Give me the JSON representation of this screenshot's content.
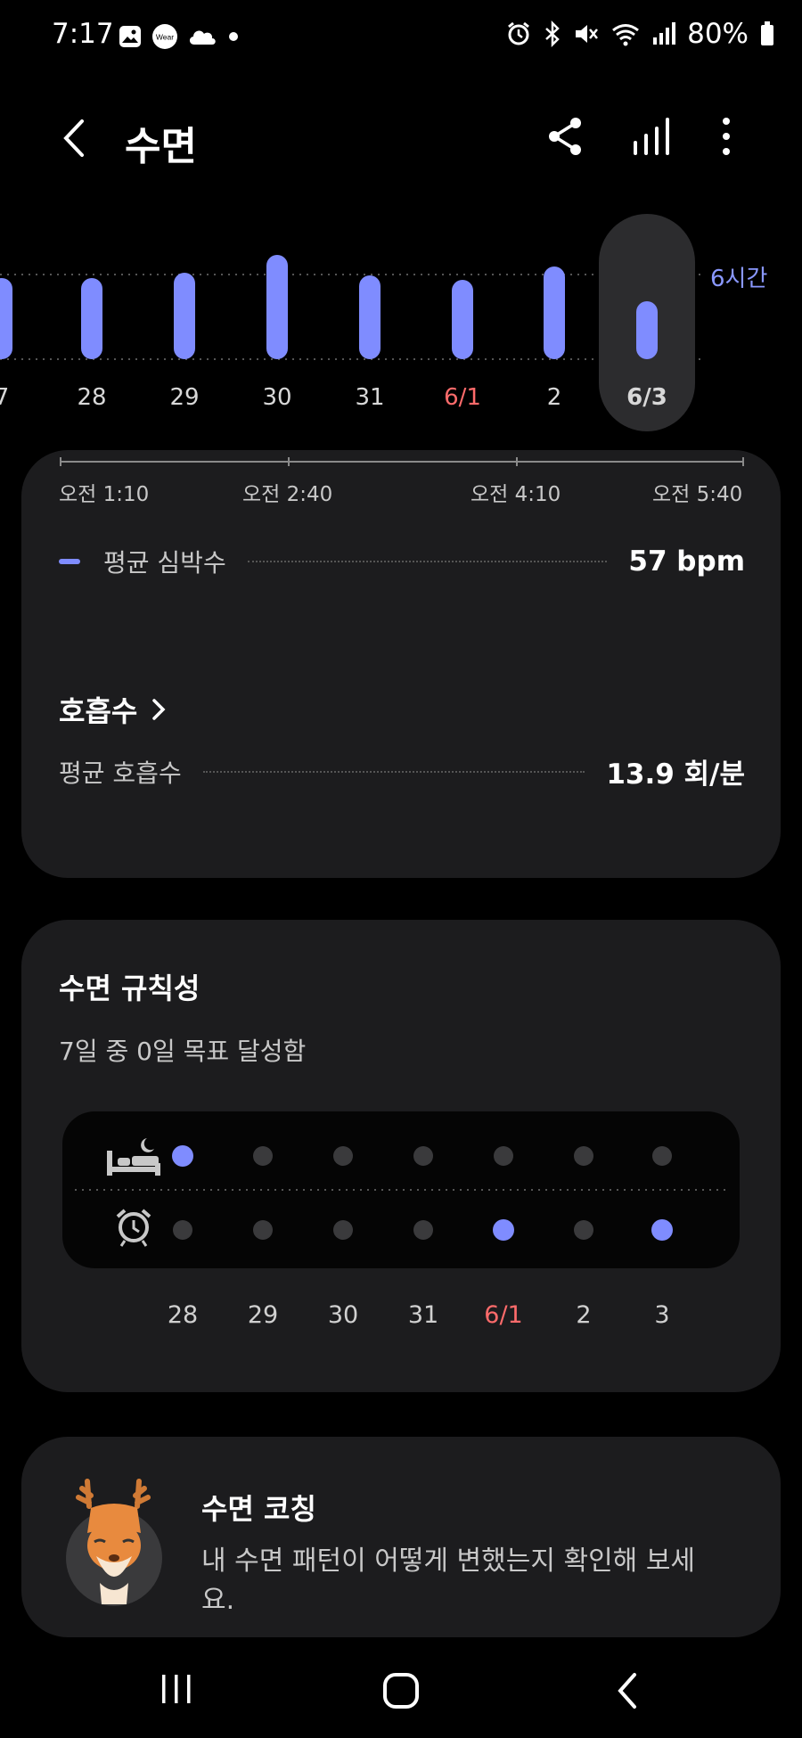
{
  "status_bar": {
    "time": "7:17",
    "battery": "80%",
    "left_icons": [
      "gallery-icon",
      "wear-icon",
      "cloud-icon",
      "dot-icon"
    ],
    "right_icons": [
      "alarm-icon",
      "bluetooth-icon",
      "mute-icon",
      "wifi-icon",
      "signal-icon",
      "battery-icon"
    ],
    "wear_label": "Wear"
  },
  "header": {
    "title": "수면"
  },
  "sleep_chart": {
    "goal_label": "6시간",
    "selected_date": "6/3",
    "dates": [
      "7",
      "28",
      "29",
      "30",
      "31",
      "6/1",
      "2",
      "6/3"
    ],
    "highlight_date": "6/1",
    "accent": "#7f8cff",
    "highlight_color": "#ff6b6b"
  },
  "heart_card": {
    "timeline_labels": [
      "오전 1:10",
      "오전 2:40",
      "오전 4:10",
      "오전 5:40"
    ],
    "avg_hr_label": "평균 심박수",
    "avg_hr_value": "57 bpm",
    "resp_title": "호흡수",
    "avg_resp_label": "평균 호흡수",
    "avg_resp_value": "13.9 회/분"
  },
  "regularity_card": {
    "title": "수면 규칙성",
    "subtitle": "7일 중 0일 목표 달성함",
    "dates": [
      "28",
      "29",
      "30",
      "31",
      "6/1",
      "2",
      "3"
    ],
    "highlight_date": "6/1",
    "bedtime_on": [
      true,
      false,
      false,
      false,
      false,
      false,
      false
    ],
    "wake_on": [
      false,
      false,
      false,
      false,
      true,
      false,
      true
    ]
  },
  "coach_card": {
    "title": "수면 코칭",
    "description": "내 수면 패턴이 어떻게 변했는지 확인해 보세요."
  }
}
